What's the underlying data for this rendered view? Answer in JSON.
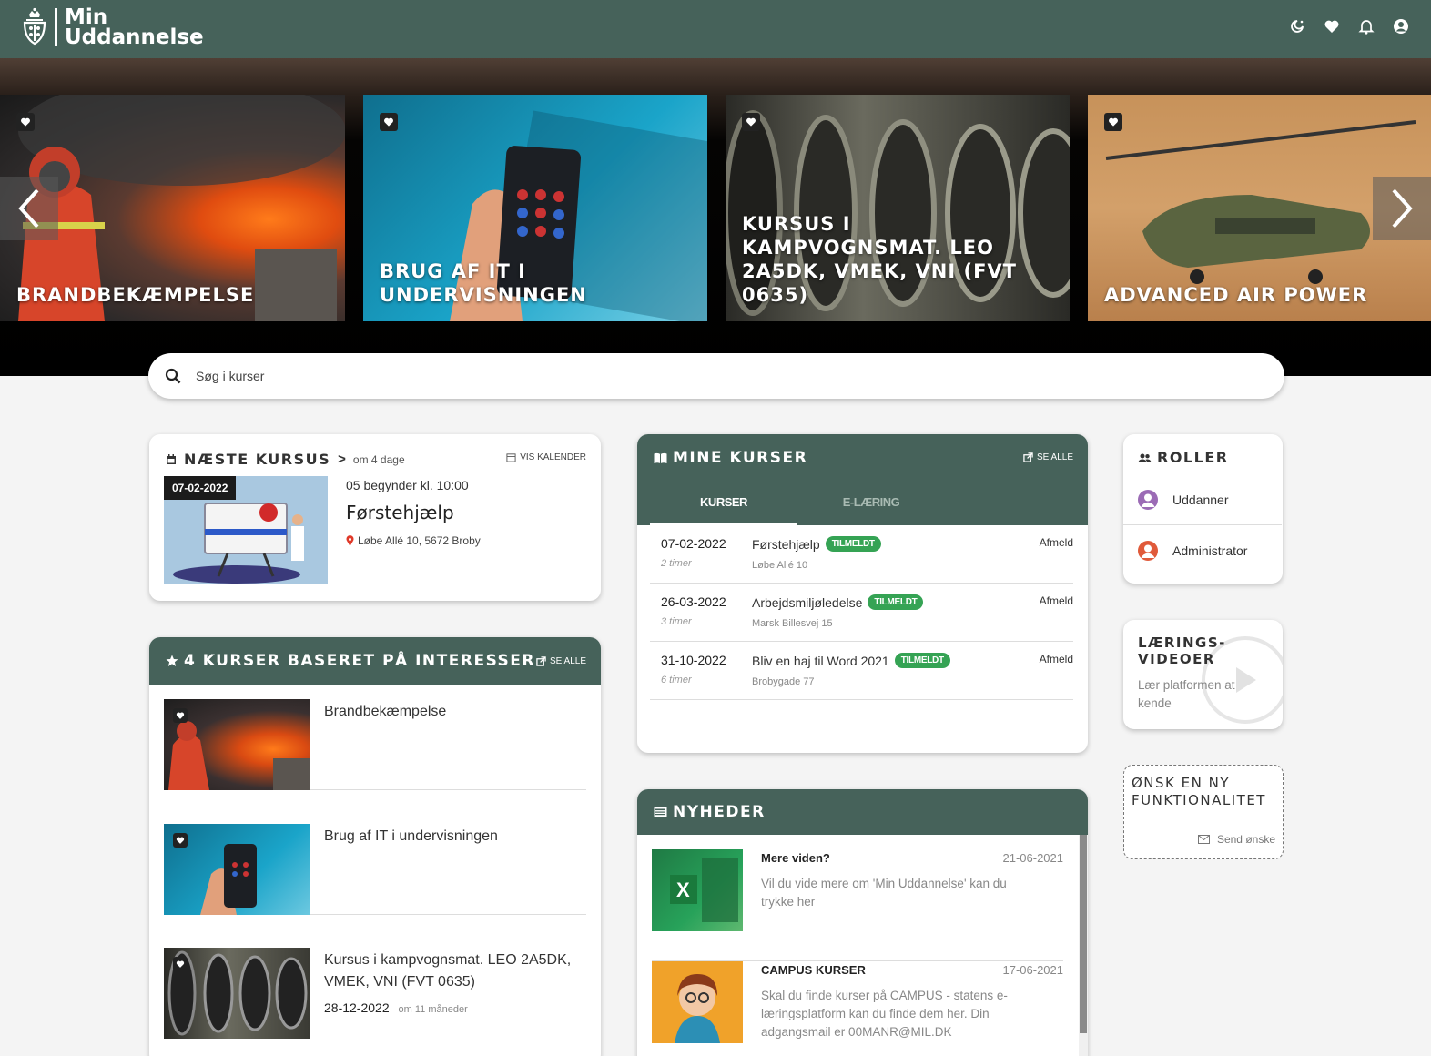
{
  "header": {
    "logo_line1": "Min",
    "logo_line2": "Uddannelse",
    "icons": [
      "theme-toggle-icon",
      "heart-icon",
      "bell-icon",
      "user-icon"
    ],
    "color": "#46625a"
  },
  "carousel": {
    "slides": [
      {
        "title": "Brandbekæmpelse"
      },
      {
        "title": "Brug af IT i undervisningen"
      },
      {
        "title": "Kursus i kampvognsmat. LEO 2A5DK, VMEK, VNI (FVT 0635)"
      },
      {
        "title": "Advanced Air Power"
      }
    ]
  },
  "search": {
    "placeholder": "Søg i kurser"
  },
  "next_course": {
    "heading": "Næste kursus",
    "arrow": ">",
    "in": "om 4 dage",
    "calendar_link": "VIS KALENDER",
    "date": "07-02-2022",
    "day": "05",
    "begins": "begynder kl.",
    "time": "10:00",
    "title": "Førstehjælp",
    "address": "Løbe Allé 10, 5672 Broby"
  },
  "interests": {
    "heading": "4 kurser baseret på interesser",
    "see_all": "SE ALLE",
    "items": [
      {
        "title": "Brandbekæmpelse"
      },
      {
        "title": "Brug af IT i undervisningen"
      },
      {
        "title": "Kursus i kampvognsmat. LEO 2A5DK, VMEK, VNI (FVT 0635)",
        "date": "28-12-2022",
        "rel": "om 11 måneder"
      }
    ]
  },
  "my_courses": {
    "heading": "Mine kurser",
    "see_all": "SE ALLE",
    "tabs": [
      "KURSER",
      "E-LÆRING"
    ],
    "rows": [
      {
        "date": "07-02-2022",
        "duration": "2 timer",
        "title": "Førstehjælp",
        "status": "TILMELDT",
        "location": "Løbe Allé 10",
        "action": "Afmeld"
      },
      {
        "date": "26-03-2022",
        "duration": "3 timer",
        "title": "Arbejdsmiljøledelse",
        "status": "TILMELDT",
        "location": "Marsk Billesvej 15",
        "action": "Afmeld"
      },
      {
        "date": "31-10-2022",
        "duration": "6 timer",
        "title": "Bliv en haj til Word 2021",
        "status": "TILMELDT",
        "location": "Brobygade 77",
        "action": "Afmeld"
      }
    ]
  },
  "news": {
    "heading": "Nyheder",
    "items": [
      {
        "title": "Mere viden?",
        "date": "21-06-2021",
        "text": "Vil du vide mere om 'Min Uddannelse' kan du trykke her"
      },
      {
        "title": "CAMPUS KURSER",
        "date": "17-06-2021",
        "text": "Skal du finde kurser på CAMPUS - statens e-læringsplatform kan du finde dem her. Din adgangsmail er 00MANR@MIL.DK"
      }
    ]
  },
  "roles": {
    "heading": "Roller",
    "items": [
      {
        "label": "Uddanner",
        "color": "#9b6bb5"
      },
      {
        "label": "Administrator",
        "color": "#e05a3a"
      }
    ]
  },
  "videos": {
    "heading_line1": "Lærings-",
    "heading_line2": "videoer",
    "text": "Lær platformen at kende"
  },
  "wish": {
    "heading_line1": "Ønsk en ny",
    "heading_line2": "funktionalitet",
    "action": "Send ønske"
  }
}
